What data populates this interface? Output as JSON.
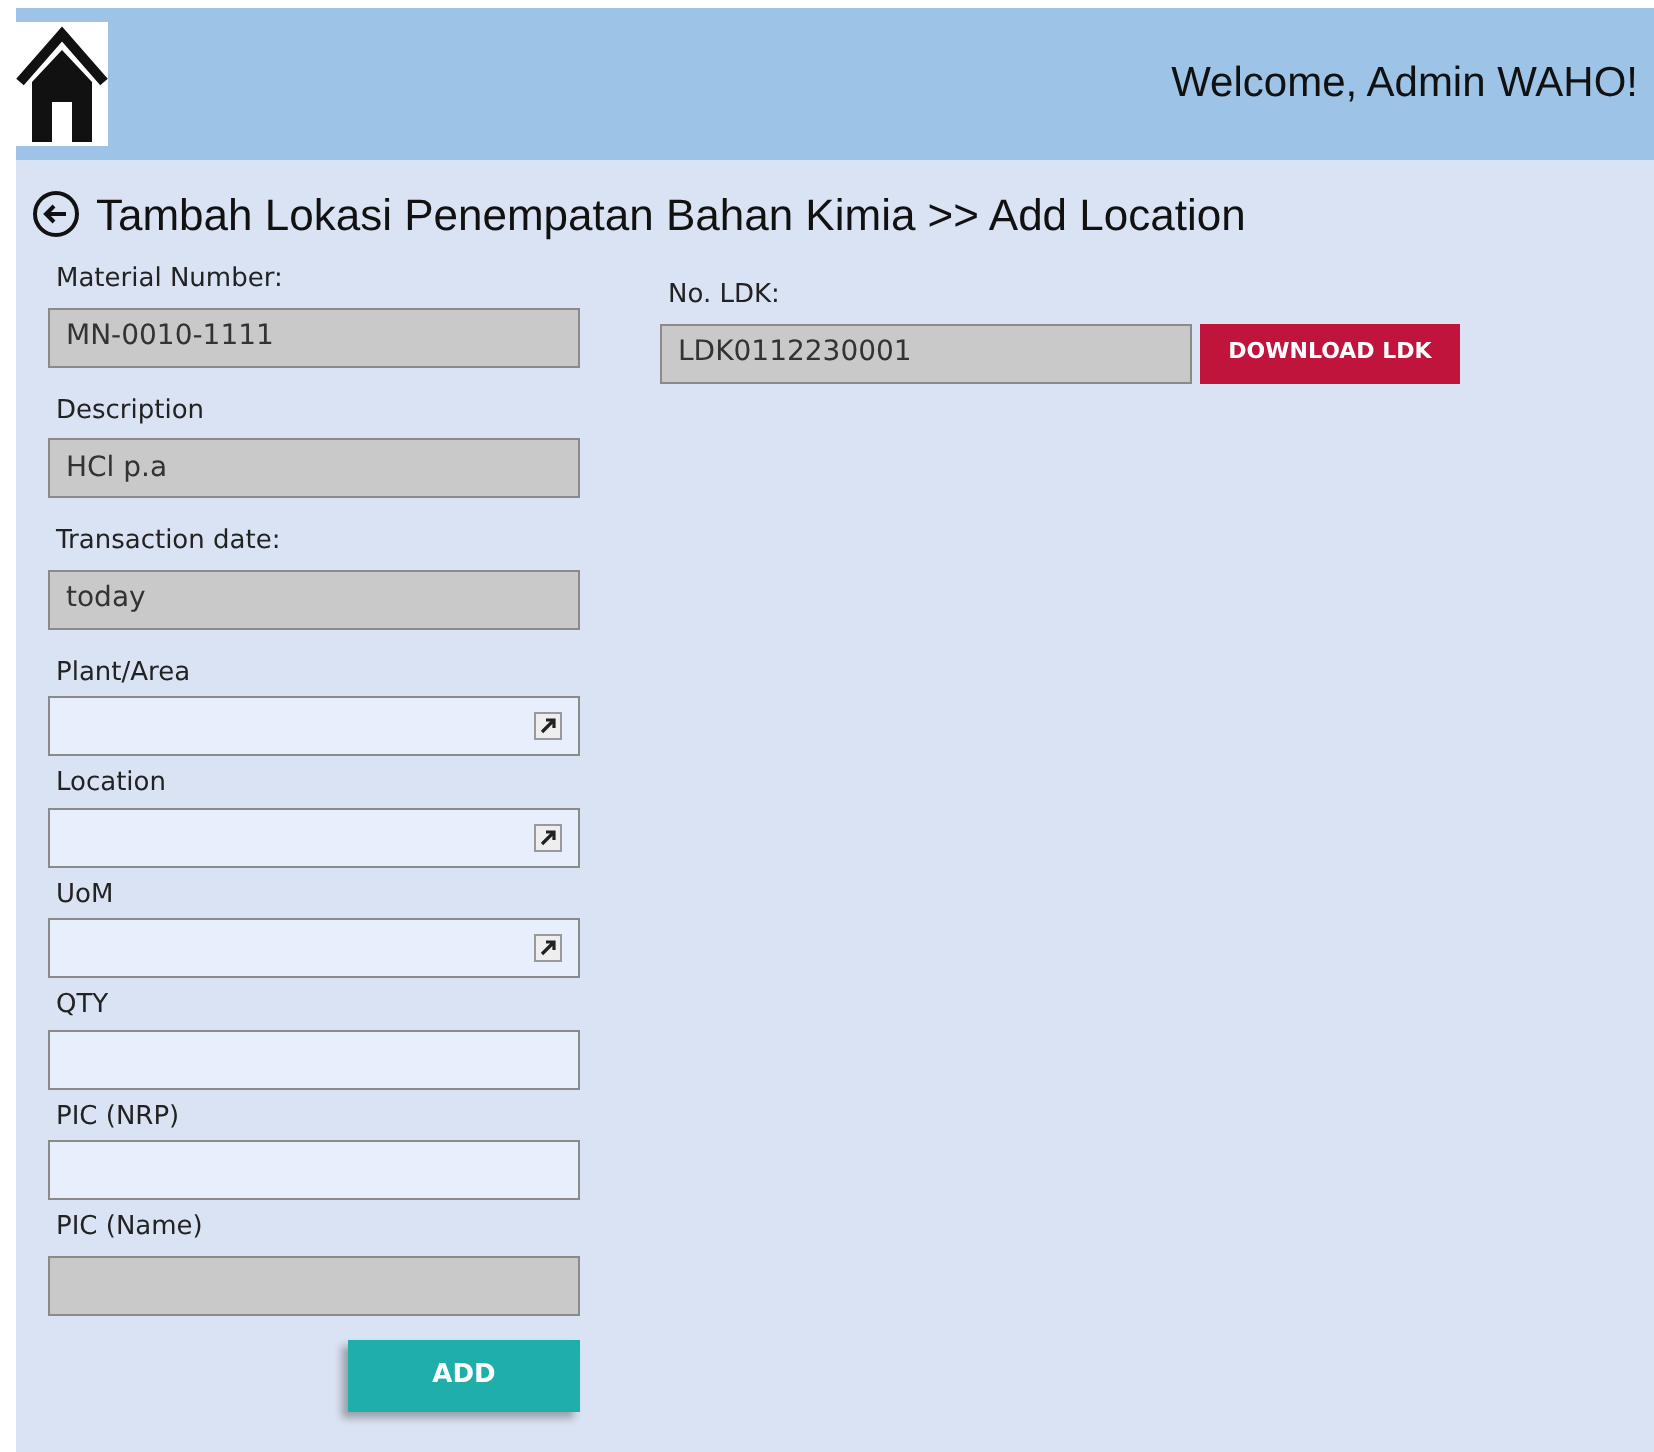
{
  "header": {
    "welcome": "Welcome, Admin WAHO!"
  },
  "page_title": "Tambah Lokasi Penempatan Bahan Kimia >> Add Location",
  "fields": [
    {
      "label": "Material Number:",
      "value": "MN-0010-1111",
      "kind": "text",
      "disabled": true
    },
    {
      "label": "Description",
      "value": "HCl p.a",
      "kind": "text",
      "disabled": true
    },
    {
      "label": "Transaction date:",
      "value": "today",
      "kind": "text",
      "disabled": true
    },
    {
      "label": "Plant/Area",
      "kind": "lookup",
      "disabled": false
    },
    {
      "label": "Location",
      "kind": "lookup",
      "disabled": false
    },
    {
      "label": "UoM",
      "kind": "lookup",
      "disabled": false
    },
    {
      "label": "QTY",
      "kind": "text",
      "disabled": false
    },
    {
      "label": "PIC (NRP)",
      "kind": "text",
      "disabled": false
    },
    {
      "label": "PIC (Name)",
      "kind": "text",
      "disabled": true
    }
  ],
  "ldk": {
    "label": "No. LDK:",
    "value": "LDK0112230001",
    "button": "DOWNLOAD LDK"
  },
  "add_button": "ADD"
}
